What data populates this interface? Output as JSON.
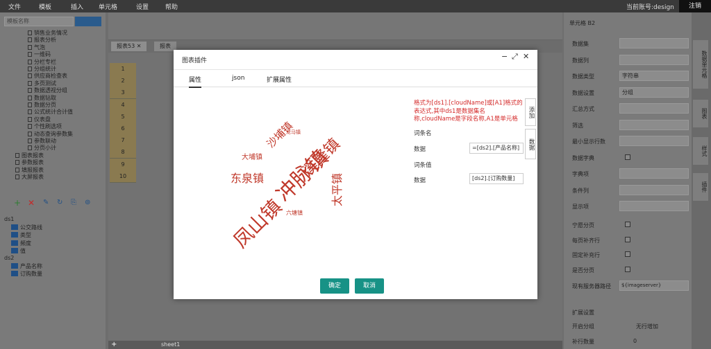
{
  "menu": [
    "文件",
    "模板",
    "插入",
    "单元格",
    "设置",
    "帮助"
  ],
  "account": "当前账号:design",
  "logout": "注销",
  "left_panel": {
    "search_placeholder": "模板名称",
    "tree_items": [
      "销售业务情况",
      "报表分析",
      "气泡",
      "一维码",
      "分栏专栏",
      "分组统计",
      "供应商检查表",
      "多页测试",
      "数据透视分组",
      "数据钻取",
      "数据分页",
      "公式统计合计值",
      "仪表盘",
      "个性刷选项",
      "动态查询参数集",
      "参数联动",
      "分页小计",
      "图表报表",
      "参数报表",
      "填报报表",
      "大屏报表"
    ],
    "datasets": [
      "ds1",
      "公交路线",
      "类型",
      "频度",
      "值",
      "ds2",
      "产品名称",
      "订购数量"
    ]
  },
  "sheet_tabs": [
    "报表53",
    "报表"
  ],
  "row_numbers": [
    "1",
    "2",
    "3",
    "4",
    "5",
    "6",
    "7",
    "8",
    "9",
    "10"
  ],
  "bottom_sheet": "sheet1",
  "right_panel": {
    "title": "单元格 B2",
    "props": [
      "数据集",
      "数据列",
      "数据类型",
      "数据设置",
      "汇总方式",
      "筛选",
      "最小显示行数",
      "数据字典",
      "字典项",
      "条件列",
      "显示项"
    ],
    "type_value": "字符串",
    "setting_value": "分组",
    "checks": [
      "宁愿分页",
      "每页补齐行",
      "固定补充行",
      "是否分页"
    ],
    "img_label": "现有服务器路径",
    "img_value": "${imageserver}",
    "tabs": [
      "扩展设置",
      "开启分组",
      "无行增加"
    ],
    "last_prop": "补行数量",
    "last_val": "0"
  },
  "side_tabs": [
    "数据单元格",
    "图表",
    "样式",
    "插件"
  ],
  "dialog": {
    "title": "图表插件",
    "tabs": [
      "属性",
      "json",
      "扩展属性"
    ],
    "hint": "格式为[ds1].[cloudName]或[A1]格式的表达式,其中ds1是数据集名称,cloudName是字段名称,A1是单元格",
    "label_group1": "词条名",
    "label_data1": "数据",
    "value_data1": "=[ds2].[产品名称]",
    "label_group2": "词条值",
    "label_data2": "数据",
    "value_data2": "[ds2].[订购数量]",
    "side_btn1": "添加",
    "side_btn2": "数据",
    "ok": "确定",
    "cancel": "取消",
    "wordcloud": [
      {
        "text": "冲脉镇",
        "weight": 30,
        "rotate": -45
      },
      {
        "text": "凤山镇",
        "weight": 28,
        "rotate": -45
      },
      {
        "text": "溪隆镇",
        "weight": 22,
        "rotate": -45
      },
      {
        "text": "东泉镇",
        "weight": 16,
        "rotate": 0
      },
      {
        "text": "沙埔镇",
        "weight": 15,
        "rotate": -45
      },
      {
        "text": "太平镇",
        "weight": 16,
        "rotate": -90
      },
      {
        "text": "大埔镇",
        "weight": 10,
        "rotate": 0
      },
      {
        "text": "六塘镇",
        "weight": 8,
        "rotate": 0
      },
      {
        "text": "龙马镇",
        "weight": 7,
        "rotate": 0
      }
    ]
  }
}
